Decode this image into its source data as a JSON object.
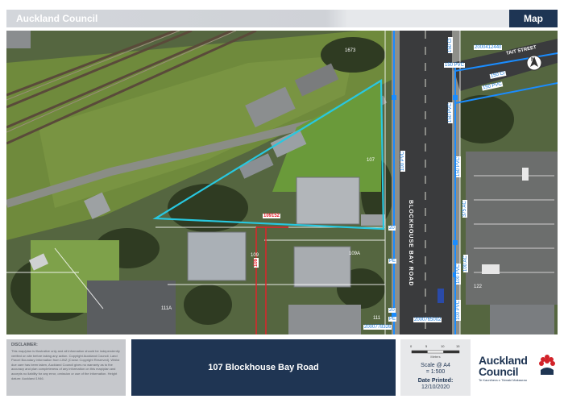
{
  "header": {
    "title": "Auckland Council",
    "badge": "Map"
  },
  "map": {
    "road_name": "BLOCKHOUSE BAY ROAD",
    "street_label": "TAIT STREET",
    "north_label": "N",
    "property_label": "109152",
    "parcel_code": "109",
    "footpath_labels": {
      "a": "20",
      "b": "PE",
      "c": "20",
      "d": "PE"
    },
    "pipe_labels": [
      "100 PVC",
      "150 PVC",
      "150 PVC",
      "150 CI",
      "150 CI",
      "150 PVC",
      "375 AC",
      "100 PVC",
      "100 AC",
      "100 PVC",
      "150 PVC"
    ],
    "asset_ids": [
      "2000412440",
      "2000778326",
      "2000765002"
    ],
    "address_numbers": [
      "107",
      "109",
      "109A",
      "111",
      "111A",
      "122",
      "1673"
    ],
    "colors": {
      "boundary": "#28c8e0",
      "pipe": "#1a8cff",
      "pipe_label": "#1a7ad8",
      "parcel_red": "#e8202a",
      "address_text": "#ffffff"
    }
  },
  "footer": {
    "disclaimer_title": "DISCLAIMER:",
    "disclaimer_text": "This map/plan is illustrative only and all information should be independently verified on site before taking any action. Copyright Auckland Council. Land Parcel Boundary information from LINZ (Crown Copyright Reserved). Whilst due care has been taken, Auckland Council gives no warranty as to the accuracy and plan completeness of any information on this map/plan and accepts no liability for any error, omission or use of the information. Height datum: Auckland 1946.",
    "address": "107 Blockhouse Bay Road",
    "scale_ticks": [
      "0",
      "5",
      "10",
      "15"
    ],
    "scale_units": "Meters",
    "scale_label": "Scale @ A4",
    "scale_value": "= 1:500",
    "date_label": "Date Printed:",
    "date_value": "12/10/2020",
    "logo_line1": "Auckland",
    "logo_line2": "Council",
    "logo_maori": "Te Kaunihera o Tāmaki Makaurau"
  }
}
